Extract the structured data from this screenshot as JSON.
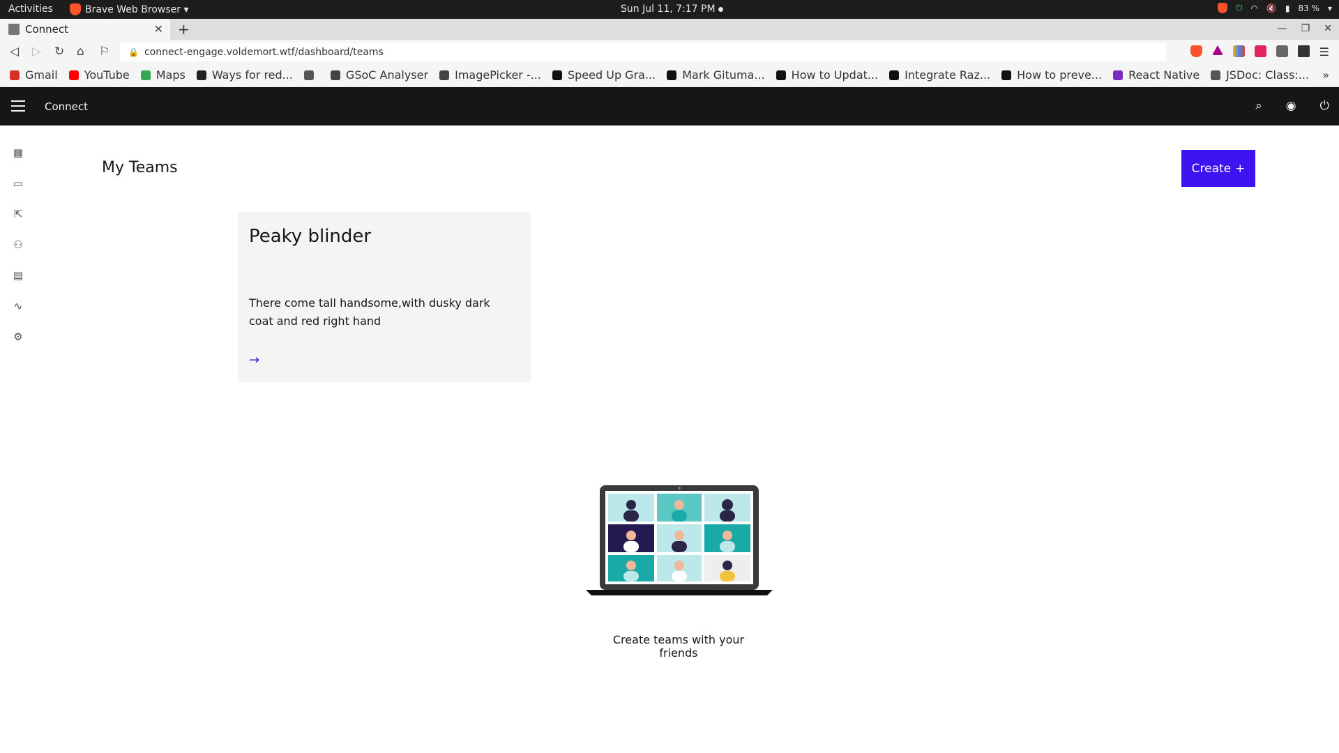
{
  "os_bar": {
    "activities": "Activities",
    "app_menu": "Brave Web Browser ▾",
    "clock": "Sun Jul 11,  7:17 PM",
    "battery": "83 %"
  },
  "browser": {
    "tab_title": "Connect",
    "url": "connect-engage.voldemort.wtf/dashboard/teams",
    "bookmarks": [
      {
        "label": "Gmail",
        "color": "#d93025"
      },
      {
        "label": "YouTube",
        "color": "#ff0000"
      },
      {
        "label": "Maps",
        "color": "#34a853"
      },
      {
        "label": "Ways for red...",
        "color": "#222222"
      },
      {
        "label": "",
        "color": "#555555"
      },
      {
        "label": "GSoC Analyser",
        "color": "#444444"
      },
      {
        "label": "ImagePicker -...",
        "color": "#444444"
      },
      {
        "label": "Speed Up Gra...",
        "color": "#111111"
      },
      {
        "label": "Mark Gituma...",
        "color": "#111111"
      },
      {
        "label": "How to Updat...",
        "color": "#111111"
      },
      {
        "label": "Integrate Raz...",
        "color": "#111111"
      },
      {
        "label": "How to preve...",
        "color": "#111111"
      },
      {
        "label": "React Native",
        "color": "#7b2cbf"
      },
      {
        "label": "JSDoc: Class:...",
        "color": "#555555"
      }
    ],
    "bookmarks_more": "»"
  },
  "app": {
    "name": "Connect",
    "page_title": "My Teams",
    "create_label": "Create",
    "create_icon": "+",
    "accent": "#3d13f0",
    "team_card": {
      "title": "Peaky blinder",
      "description": "There come tall handsome,with dusky dark coat and red right hand",
      "arrow": "→"
    },
    "empty_caption": "Create teams with your friends"
  }
}
